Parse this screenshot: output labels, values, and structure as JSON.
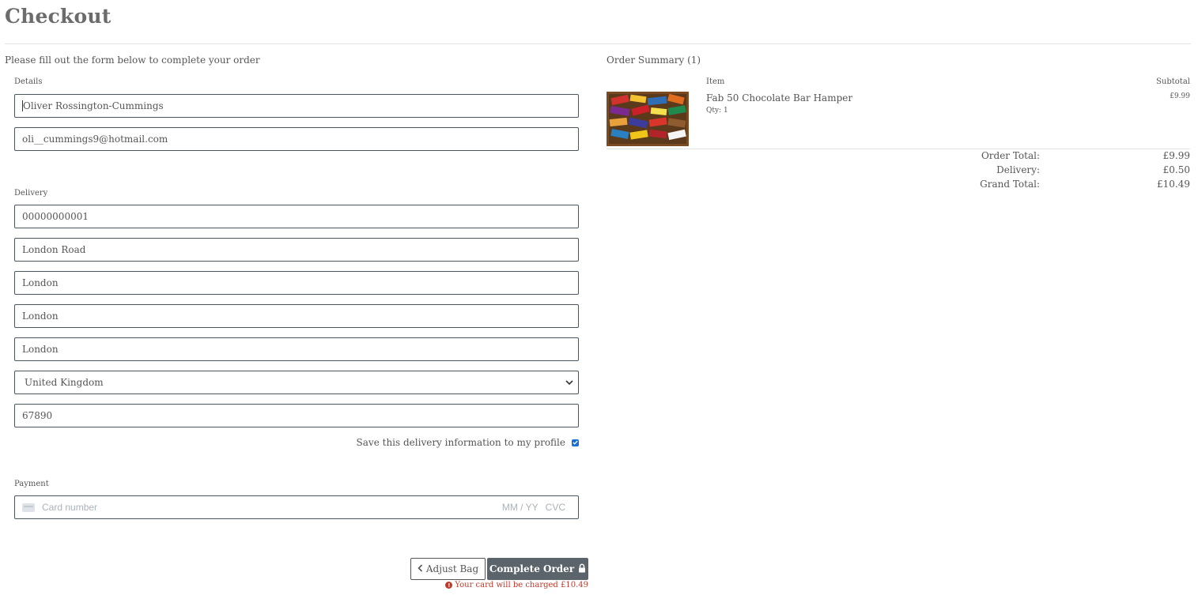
{
  "page": {
    "title": "Checkout",
    "intro": "Please fill out the form below to complete your order"
  },
  "form": {
    "details_label": "Details",
    "full_name": "Oliver Rossington-Cummings",
    "email": "oli__cummings9@hotmail.com",
    "delivery_label": "Delivery",
    "phone": "00000000001",
    "street_address": "London Road",
    "town_or_city": "London",
    "county": "London",
    "area": "London",
    "country": "United Kingdom",
    "postcode": "67890",
    "save_info_label": "Save this delivery information to my profile",
    "save_info_checked": true,
    "payment_label": "Payment",
    "card_placeholder": "Card number",
    "expiry_placeholder": "MM / YY",
    "cvc_placeholder": "CVC"
  },
  "actions": {
    "adjust_bag_label": "Adjust Bag",
    "adjust_bag_icon": "chevron-left-icon",
    "complete_order_label": "Complete Order",
    "complete_order_icon": "lock-icon",
    "charge_notice": "Your card will be charged £10.49",
    "charge_notice_icon": "exclamation-circle-icon"
  },
  "summary": {
    "title": "Order Summary (1)",
    "item_header": "Item",
    "subtotal_header": "Subtotal",
    "items": [
      {
        "name": "Fab 50 Chocolate Bar Hamper",
        "qty": "Qty: 1",
        "subtotal": "£9.99"
      }
    ],
    "order_total_label": "Order Total:",
    "order_total": "£9.99",
    "delivery_label": "Delivery:",
    "delivery": "£0.50",
    "grand_total_label": "Grand Total:",
    "grand_total": "£10.49"
  },
  "colors": {
    "primary_button": "#5c646b",
    "warning_text": "#c0392b",
    "checkbox": "#1a6fd1"
  }
}
